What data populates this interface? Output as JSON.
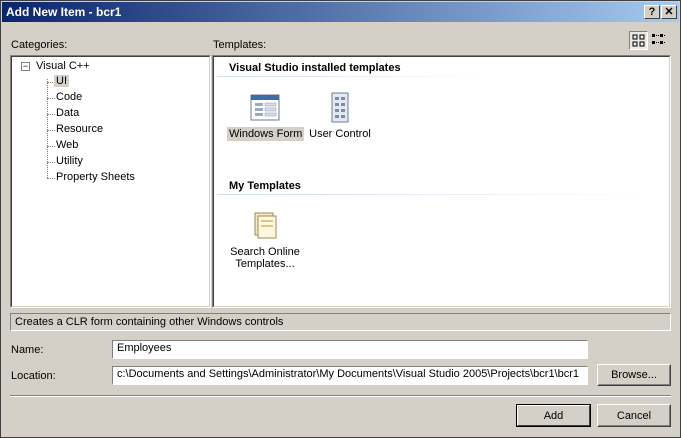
{
  "window": {
    "title": "Add New Item - bcr1",
    "help_label": "?",
    "close_label": "✕"
  },
  "categories": {
    "label": "Categories:",
    "root": {
      "label": "Visual C++",
      "expander": "−"
    },
    "items": [
      {
        "label": "UI",
        "selected": true
      },
      {
        "label": "Code"
      },
      {
        "label": "Data"
      },
      {
        "label": "Resource"
      },
      {
        "label": "Web"
      },
      {
        "label": "Utility"
      },
      {
        "label": "Property Sheets"
      }
    ]
  },
  "templates": {
    "label": "Templates:",
    "installed_header": "Visual Studio installed templates",
    "installed": [
      {
        "label": "Windows Form",
        "icon": "windows-form-icon",
        "selected": true
      },
      {
        "label": "User Control",
        "icon": "user-control-icon"
      }
    ],
    "my_header": "My Templates",
    "my": [
      {
        "label_line1": "Search Online",
        "label_line2": "Templates...",
        "icon": "search-online-templates-icon"
      }
    ],
    "view_modes": [
      "large-icons-view-icon",
      "small-icons-view-icon"
    ]
  },
  "description": "Creates a CLR form containing other Windows controls",
  "name_field": {
    "label": "Name:",
    "value": "Employees"
  },
  "location_field": {
    "label": "Location:",
    "value": "c:\\Documents and Settings\\Administrator\\My Documents\\Visual Studio 2005\\Projects\\bcr1\\bcr1"
  },
  "buttons": {
    "browse": "Browse...",
    "add": "Add",
    "cancel": "Cancel"
  },
  "colors": {
    "titlebar_start": "#0a246a",
    "titlebar_end": "#a6caf0",
    "face": "#d4d0c8"
  }
}
